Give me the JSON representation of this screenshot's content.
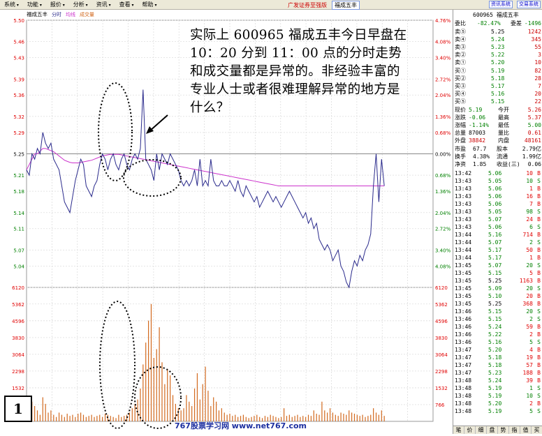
{
  "menu": [
    "系统",
    "功能",
    "报价",
    "分析",
    "资讯",
    "查看",
    "帮助"
  ],
  "app_title": "广发证券至强版",
  "title_stock": "福成五丰",
  "sys_buttons": [
    "资讯系统",
    "交易系统"
  ],
  "chart": {
    "stock_name": "福成五丰",
    "tabs": [
      "分时",
      "均线",
      "成交量"
    ],
    "price_labels": [
      "5.50",
      "5.46",
      "5.43",
      "5.39",
      "5.36",
      "5.32",
      "5.29",
      "5.25",
      "5.21",
      "5.18",
      "5.14",
      "5.11",
      "5.07",
      "5.04"
    ],
    "pct_labels": [
      "4.76%",
      "4.08%",
      "3.40%",
      "2.72%",
      "2.04%",
      "1.36%",
      "0.68%",
      "0.00%",
      "0.68%",
      "1.36%",
      "2.04%",
      "2.72%",
      "3.40%",
      "4.08%"
    ],
    "vol_labels": [
      "6120",
      "5362",
      "4596",
      "3830",
      "3064",
      "2298",
      "1532",
      "766"
    ],
    "price_series": [
      5.22,
      5.21,
      5.25,
      5.24,
      5.26,
      5.25,
      5.29,
      5.27,
      5.26,
      5.27,
      5.24,
      5.23,
      5.22,
      5.19,
      5.16,
      5.15,
      5.14,
      5.17,
      5.2,
      5.22,
      5.24,
      5.23,
      5.19,
      5.18,
      5.17,
      5.19,
      5.2,
      5.23,
      5.25,
      5.24,
      5.22,
      5.24,
      5.25,
      5.23,
      5.22,
      5.24,
      5.25,
      5.23,
      5.22,
      5.24,
      5.25,
      5.24,
      5.26,
      5.37,
      5.24,
      5.23,
      5.22,
      5.2,
      5.25,
      5.22,
      5.25,
      5.24,
      5.23,
      5.25,
      5.24,
      5.23,
      5.22,
      5.2,
      5.19,
      5.2,
      5.19,
      5.2,
      5.22,
      5.19,
      5.24,
      5.19,
      5.2,
      5.19,
      5.24,
      5.2,
      5.19,
      5.19,
      5.2,
      5.19,
      5.19,
      5.2,
      5.19,
      5.18,
      5.2,
      5.18,
      5.17,
      5.19,
      5.18,
      5.17,
      5.16,
      5.17,
      5.15,
      5.16,
      5.17,
      5.18,
      5.17,
      5.16,
      5.17,
      5.16,
      5.15,
      5.16,
      5.17,
      5.18,
      5.17,
      5.16,
      5.15,
      5.14,
      5.13,
      5.14,
      5.12,
      5.13,
      5.11,
      5.12,
      5.09,
      5.08,
      5.07,
      5.08,
      5.07,
      5.05,
      5.06,
      5.07,
      5.04,
      5.03,
      5.01,
      5.0,
      5.03,
      5.05,
      5.04,
      5.06,
      5.05,
      5.07,
      5.08,
      5.1,
      5.19,
      5.25,
      5.16,
      5.24,
      5.19
    ],
    "avg_series": [
      5.22,
      5.23,
      5.24,
      5.25,
      5.25,
      5.255,
      5.26,
      5.26,
      5.258,
      5.256,
      5.254,
      5.25,
      5.246,
      5.242,
      5.238,
      5.236,
      5.234,
      5.233,
      5.233,
      5.233,
      5.234,
      5.235,
      5.236,
      5.237,
      5.238,
      5.24,
      5.242,
      5.244,
      5.246,
      5.247,
      5.248,
      5.249,
      5.249,
      5.249,
      5.249,
      5.248,
      5.247,
      5.246,
      5.245,
      5.244,
      5.243,
      5.242,
      5.241,
      5.24,
      5.239,
      5.238,
      5.237,
      5.236,
      5.235,
      5.234,
      5.233,
      5.232,
      5.231,
      5.23,
      5.229,
      5.228,
      5.227,
      5.226,
      5.225,
      5.224,
      5.223,
      5.222,
      5.221,
      5.22,
      5.219,
      5.218,
      5.217,
      5.216,
      5.215,
      5.214,
      5.213,
      5.212,
      5.211,
      5.21,
      5.209,
      5.208,
      5.207,
      5.206,
      5.205,
      5.204,
      5.203,
      5.202,
      5.201,
      5.2,
      5.199,
      5.198,
      5.197,
      5.196,
      5.195,
      5.194,
      5.193,
      5.192,
      5.191,
      5.19,
      5.19,
      5.19,
      5.19,
      5.19,
      5.19,
      5.19,
      5.19,
      5.19,
      5.19,
      5.19,
      5.19,
      5.19,
      5.19,
      5.19,
      5.19,
      5.19,
      5.19,
      5.19,
      5.19,
      5.19,
      5.19,
      5.19,
      5.19,
      5.19,
      5.19,
      5.19,
      5.19,
      5.19,
      5.19,
      5.19,
      5.19,
      5.19,
      5.19,
      5.19,
      5.19,
      5.19,
      5.19,
      5.19,
      5.19
    ],
    "volume_series": [
      600,
      400,
      900,
      700,
      500,
      300,
      1100,
      800,
      400,
      500,
      300,
      200,
      400,
      300,
      200,
      350,
      250,
      300,
      200,
      350,
      400,
      300,
      200,
      250,
      300,
      200,
      250,
      300,
      200,
      350,
      300,
      250,
      200,
      150,
      300,
      200,
      250,
      300,
      400,
      600,
      800,
      1000,
      1500,
      2600,
      3600,
      4600,
      5362,
      2900,
      3300,
      4300,
      2700,
      1700,
      2400,
      2100,
      1200,
      800,
      600,
      500,
      600,
      1200,
      900,
      700,
      1500,
      2200,
      1000,
      1700,
      2500,
      1400,
      700,
      1100,
      900,
      500,
      600,
      400,
      300,
      350,
      250,
      300,
      200,
      250,
      300,
      200,
      150,
      200,
      250,
      300,
      200,
      150,
      250,
      200,
      300,
      250,
      200,
      150,
      200,
      600,
      250,
      300,
      200,
      250,
      300,
      200,
      250,
      200,
      300,
      250,
      500,
      350,
      300,
      900,
      500,
      400,
      600,
      400,
      300,
      250,
      400,
      350,
      300,
      500,
      400,
      350,
      300,
      250,
      300,
      200,
      250,
      300,
      600,
      400,
      300,
      500,
      250
    ],
    "price_max": 5.5,
    "price_min": 5.0,
    "prev_close": 5.25,
    "vol_max": 6120
  },
  "annotation_text": "实际上 600965 福成五丰今日早盘在 10：20 分到 11：00 点的分时走势和成交量都是异常的。非经验丰富的专业人士或者很难理解异常的地方是什么？",
  "figure_number": "1",
  "watermark": "767股票学习网 www.net767.com",
  "panel": {
    "header": "600965 福成五丰",
    "webi_label": "委比",
    "webi_value": "-82.47%",
    "weicha_label": "委差",
    "weicha_value": "-1496",
    "sells": [
      {
        "label": "卖⑤",
        "price": "5.25",
        "vol": "1242"
      },
      {
        "label": "卖④",
        "price": "5.24",
        "vol": "345"
      },
      {
        "label": "卖③",
        "price": "5.23",
        "vol": "55"
      },
      {
        "label": "卖②",
        "price": "5.22",
        "vol": "3"
      },
      {
        "label": "卖①",
        "price": "5.20",
        "vol": "10"
      }
    ],
    "buys": [
      {
        "label": "买①",
        "price": "5.19",
        "vol": "82"
      },
      {
        "label": "买②",
        "price": "5.18",
        "vol": "28"
      },
      {
        "label": "买③",
        "price": "5.17",
        "vol": "7"
      },
      {
        "label": "买④",
        "price": "5.16",
        "vol": "20"
      },
      {
        "label": "买⑤",
        "price": "5.15",
        "vol": "22"
      }
    ],
    "stats": [
      {
        "l1": "现价",
        "v1": "5.19",
        "l2": "今开",
        "v2": "5.26"
      },
      {
        "l1": "涨跌",
        "v1": "-0.06",
        "l2": "最高",
        "v2": "5.37"
      },
      {
        "l1": "涨幅",
        "v1": "-1.14%",
        "l2": "最低",
        "v2": "5.00"
      },
      {
        "l1": "总量",
        "v1": "87003",
        "l2": "量比",
        "v2": "0.61"
      },
      {
        "l1": "外盘",
        "v1": "38842",
        "l2": "内盘",
        "v2": "48161"
      }
    ],
    "stats2": [
      {
        "l1": "市盈",
        "v1": "67.7",
        "l2": "股本",
        "v2": "2.79亿"
      },
      {
        "l1": "换手",
        "v1": "4.38%",
        "l2": "流通",
        "v2": "1.99亿"
      },
      {
        "l1": "净资",
        "v1": "1.85",
        "l2": "收益(三)",
        "v2": "0.06"
      }
    ],
    "ticks": [
      {
        "t": "13:42",
        "p": "5.06",
        "v": "10",
        "d": "B"
      },
      {
        "t": "13:43",
        "p": "5.05",
        "v": "10",
        "d": "S"
      },
      {
        "t": "13:43",
        "p": "5.06",
        "v": "1",
        "d": "B"
      },
      {
        "t": "13:43",
        "p": "5.06",
        "v": "16",
        "d": "B"
      },
      {
        "t": "13:43",
        "p": "5.06",
        "v": "7",
        "d": "B"
      },
      {
        "t": "13:43",
        "p": "5.05",
        "v": "98",
        "d": "S"
      },
      {
        "t": "13:43",
        "p": "5.07",
        "v": "24",
        "d": "B"
      },
      {
        "t": "13:43",
        "p": "5.06",
        "v": "6",
        "d": "S"
      },
      {
        "t": "13:44",
        "p": "5.16",
        "v": "714",
        "d": "B"
      },
      {
        "t": "13:44",
        "p": "5.07",
        "v": "2",
        "d": "S"
      },
      {
        "t": "13:44",
        "p": "5.17",
        "v": "50",
        "d": "B"
      },
      {
        "t": "13:44",
        "p": "5.17",
        "v": "1",
        "d": "B"
      },
      {
        "t": "13:45",
        "p": "5.07",
        "v": "20",
        "d": "S"
      },
      {
        "t": "13:45",
        "p": "5.15",
        "v": "5",
        "d": "B"
      },
      {
        "t": "13:45",
        "p": "5.25",
        "v": "1163",
        "d": "B"
      },
      {
        "t": "13:45",
        "p": "5.09",
        "v": "20",
        "d": "S"
      },
      {
        "t": "13:45",
        "p": "5.10",
        "v": "20",
        "d": "B"
      },
      {
        "t": "13:45",
        "p": "5.25",
        "v": "368",
        "d": "B"
      },
      {
        "t": "13:46",
        "p": "5.15",
        "v": "20",
        "d": "S"
      },
      {
        "t": "13:46",
        "p": "5.15",
        "v": "2",
        "d": "S"
      },
      {
        "t": "13:46",
        "p": "5.24",
        "v": "59",
        "d": "B"
      },
      {
        "t": "13:46",
        "p": "5.22",
        "v": "2",
        "d": "B"
      },
      {
        "t": "13:46",
        "p": "5.16",
        "v": "5",
        "d": "S"
      },
      {
        "t": "13:47",
        "p": "5.20",
        "v": "4",
        "d": "B"
      },
      {
        "t": "13:47",
        "p": "5.18",
        "v": "19",
        "d": "B"
      },
      {
        "t": "13:47",
        "p": "5.18",
        "v": "57",
        "d": "B"
      },
      {
        "t": "13:47",
        "p": "5.23",
        "v": "188",
        "d": "B"
      },
      {
        "t": "13:48",
        "p": "5.24",
        "v": "39",
        "d": "B"
      },
      {
        "t": "13:48",
        "p": "5.19",
        "v": "1",
        "d": "S"
      },
      {
        "t": "13:48",
        "p": "5.19",
        "v": "10",
        "d": "S"
      },
      {
        "t": "13:48",
        "p": "5.20",
        "v": "2",
        "d": "B"
      },
      {
        "t": "13:48",
        "p": "5.19",
        "v": "5",
        "d": "S"
      }
    ],
    "bottom_tabs": [
      "笔",
      "价",
      "细",
      "盘",
      "势",
      "指",
      "值",
      "买"
    ]
  },
  "colors": {
    "up": "#e00000",
    "down": "#008000",
    "price_line": "#2a2a8c",
    "avg_line": "#cc33cc",
    "volume": "#d2691e"
  }
}
